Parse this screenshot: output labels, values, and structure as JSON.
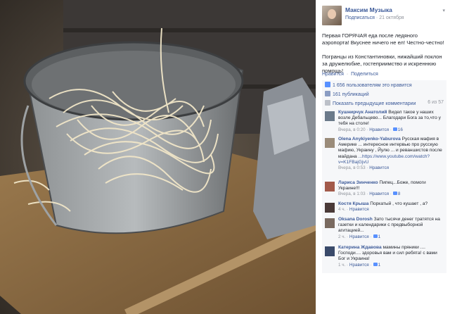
{
  "post": {
    "author": "Максим Музыка",
    "subscribe": "Подписаться",
    "date": "21 октября",
    "paragraph1": "Первая ГОРЯЧАЯ еда после ледяного аэропорта! Вкуснее ничего не ел! Честно-честно!",
    "paragraph2": "Погранцы из Константиновки, нижайший поклон за дружелюбие, гостеприимство и искреннюю помощь!",
    "like_label": "Нравится",
    "share_label": "Поделиться"
  },
  "stats": {
    "likes": "1 656 пользователям это нравится",
    "shares": "161 публикаций",
    "prev_comments": "Показать предыдущие комментарии",
    "prev_count": "6 из 57"
  },
  "comments": [
    {
      "name": "Кушнирчук Анатолий",
      "text": "Видел такое у наших возле Дебальцево... Благодари Бога за то,что у тебя на столе!",
      "link": "",
      "time": "Вчера, в 0:20",
      "like": "Нравится",
      "likes": "16",
      "avatar_color": "#6b7a8a"
    },
    {
      "name": "Olena Anykiyenko-Yaburova",
      "text": "Русская мафия в Америке ... интересное интервью про русскую мафию, Украину , Йулю ... и реваншистов после майдана",
      "link": "...https://www.youtube.com/watch?v=K1FBajGjvU",
      "time": "Вчера, в 0:53",
      "like": "Нравится",
      "likes": "",
      "avatar_color": "#9b8c7a"
    },
    {
      "name": "Лариса Зинченко",
      "text": "Пипец...Боже, помоги Украине!!!",
      "link": "",
      "time": "Вчера, в 1:03",
      "like": "Нравится",
      "likes": "8",
      "avatar_color": "#a25a4a"
    },
    {
      "name": "Костя Крыша",
      "text": "Поркатый , что кушает , а?",
      "link": "",
      "time": "4 ч.",
      "like": "Нравится",
      "likes": "",
      "avatar_color": "#4a3a38"
    },
    {
      "name": "Oksana Dorosh",
      "text": "Зато тысячи денег тратятся на газетки и календарики с предвыборной агитацией...",
      "link": "",
      "time": "2 ч.",
      "like": "Нравится",
      "likes": "1",
      "avatar_color": "#7a6a60"
    },
    {
      "name": "Катерина Ждавова",
      "text": "мамины пряники .... Господи.... здоровья вам и сил ребята! с вами Бог и Украина!",
      "link": "",
      "time": "1 ч.",
      "like": "Нравится",
      "likes": "1",
      "avatar_color": "#3a4a6a"
    }
  ],
  "colors": {
    "link": "#3b5998",
    "muted": "#90949c",
    "frame": "#000000"
  }
}
